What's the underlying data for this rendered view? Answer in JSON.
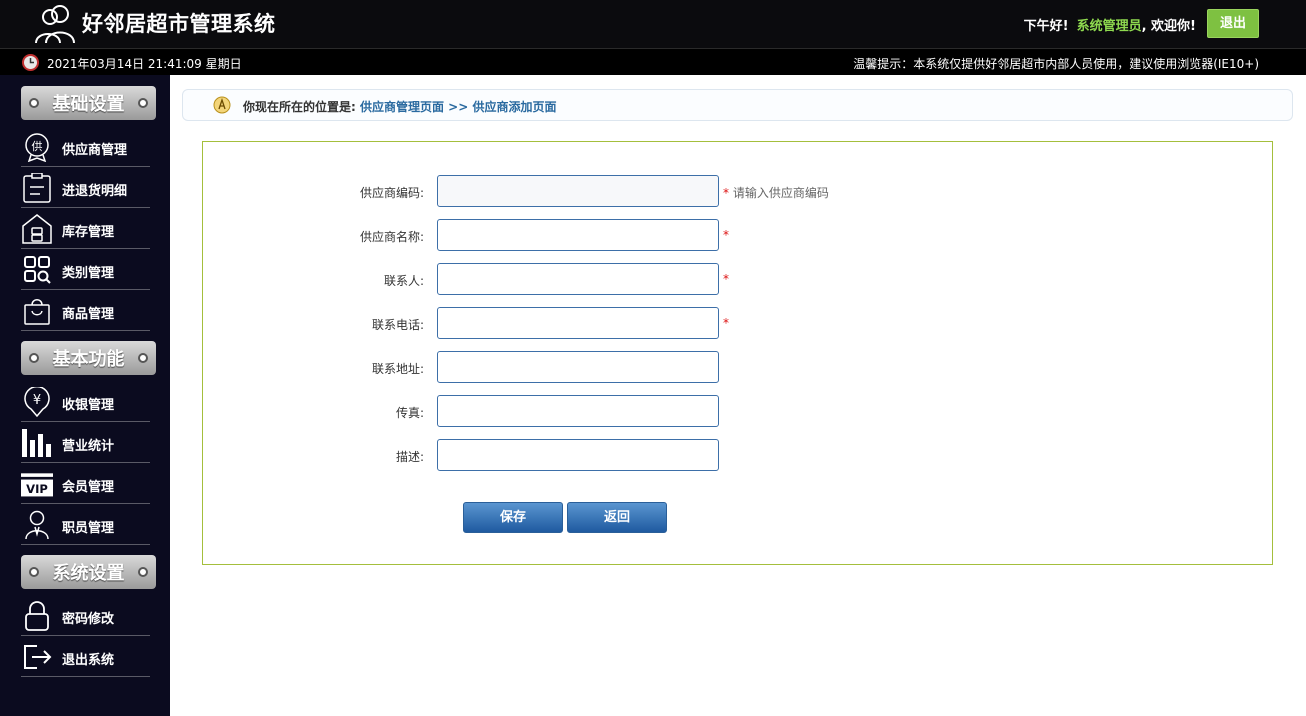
{
  "header": {
    "app_title": "好邻居超市管理系统",
    "greeting": "下午好!",
    "user": "系统管理员",
    "welcome": ", 欢迎你!",
    "logout_label": "退出"
  },
  "infobar": {
    "datetime": "2021年03月14日 21:41:09 星期日",
    "tips": "温馨提示：本系统仅提供好邻居超市内部人员使用，建议使用浏览器(IE10+)"
  },
  "sidebar": {
    "sections": [
      {
        "title": "基础设置",
        "items": [
          {
            "label": "供应商管理",
            "icon": "supplier-icon"
          },
          {
            "label": "进退货明细",
            "icon": "clipboard-icon"
          },
          {
            "label": "库存管理",
            "icon": "warehouse-icon"
          },
          {
            "label": "类别管理",
            "icon": "category-grid-icon"
          },
          {
            "label": "商品管理",
            "icon": "shopping-bag-icon"
          }
        ]
      },
      {
        "title": "基本功能",
        "items": [
          {
            "label": "收银管理",
            "icon": "yuan-pin-icon"
          },
          {
            "label": "营业统计",
            "icon": "bar-chart-icon"
          },
          {
            "label": "会员管理",
            "icon": "vip-card-icon"
          },
          {
            "label": "职员管理",
            "icon": "staff-icon"
          }
        ]
      },
      {
        "title": "系统设置",
        "items": [
          {
            "label": "密码修改",
            "icon": "lock-icon"
          },
          {
            "label": "退出系统",
            "icon": "exit-icon"
          }
        ]
      }
    ]
  },
  "breadcrumb": {
    "prefix": "你现在所在的位置是: ",
    "link1": "供应商管理页面",
    "sep": " >> ",
    "link2": "供应商添加页面"
  },
  "form": {
    "fields": [
      {
        "label": "供应商编码:",
        "value": "",
        "required": true,
        "hint": "请输入供应商编码"
      },
      {
        "label": "供应商名称:",
        "value": "",
        "required": true,
        "hint": ""
      },
      {
        "label": "联系人:",
        "value": "",
        "required": true,
        "hint": ""
      },
      {
        "label": "联系电话:",
        "value": "",
        "required": true,
        "hint": ""
      },
      {
        "label": "联系地址:",
        "value": "",
        "required": false,
        "hint": ""
      },
      {
        "label": "传真:",
        "value": "",
        "required": false,
        "hint": ""
      },
      {
        "label": "描述:",
        "value": "",
        "required": false,
        "hint": ""
      }
    ],
    "save_label": "保存",
    "back_label": "返回"
  },
  "colors": {
    "topbar": "#0b0b0e",
    "sidebar": "#0b0b1f",
    "user_name": "#8ed94f",
    "logout": "#7ec141",
    "panel_border": "#a4bf3c",
    "button": "#2a6ab0",
    "required": "#dd1111"
  }
}
